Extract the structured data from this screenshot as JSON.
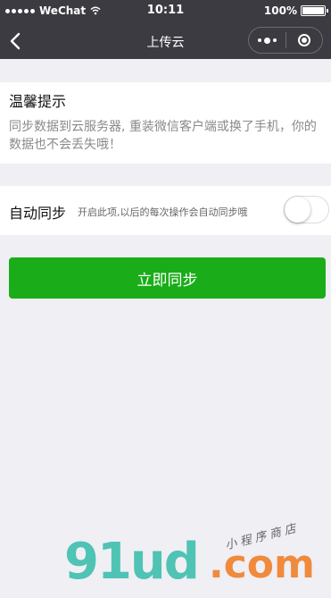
{
  "status_bar": {
    "carrier": "WeChat",
    "time": "10:11",
    "battery": "100%"
  },
  "nav": {
    "title": "上传云"
  },
  "notice": {
    "title": "温馨提示",
    "body": "同步数据到云服务器, 重装微信客户端或换了手机，你的数据也不会丢失哦！"
  },
  "auto_sync": {
    "label": "自动同步",
    "hint": "开启此项,以后的每次操作会自动同步哦",
    "enabled": false
  },
  "sync_button": {
    "label": "立即同步",
    "color": "#1aad19"
  },
  "watermark": {
    "logo": "91ud",
    "suffix": ".com",
    "tagline": "小程序商店"
  },
  "colors": {
    "nav_bg": "#3c3b41",
    "page_bg": "#efeff4",
    "primary": "#1aad19"
  }
}
